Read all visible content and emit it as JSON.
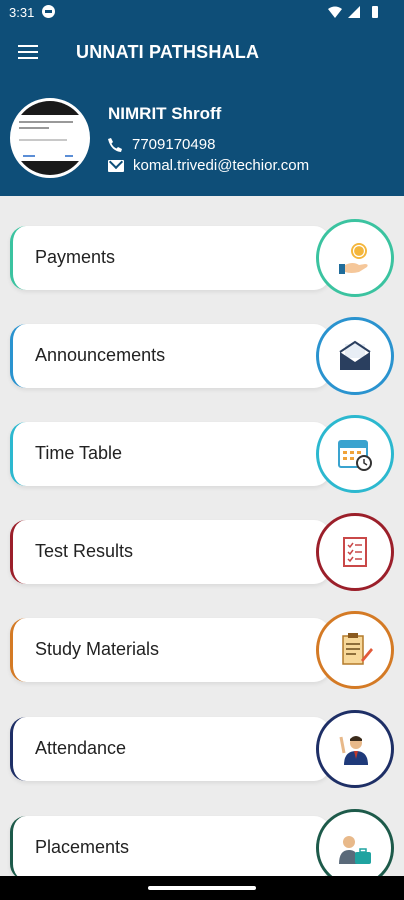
{
  "status": {
    "time": "3:31"
  },
  "appbar": {
    "title": "UNNATI PATHSHALA"
  },
  "profile": {
    "name": "NIMRIT Shroff",
    "phone": "7709170498",
    "email": "komal.trivedi@techior.com"
  },
  "menu": [
    {
      "label": "Payments",
      "color": "#3bc3a0",
      "icon": "hand-coin-icon"
    },
    {
      "label": "Announcements",
      "color": "#2a93cf",
      "icon": "envelope-icon"
    },
    {
      "label": "Time Table",
      "color": "#2cb8cf",
      "icon": "calendar-clock-icon"
    },
    {
      "label": "Test Results",
      "color": "#9b1f2a",
      "icon": "clipboard-check-icon"
    },
    {
      "label": "Study Materials",
      "color": "#d47a25",
      "icon": "notes-pencil-icon"
    },
    {
      "label": "Attendance",
      "color": "#1e2f66",
      "icon": "person-raised-hand-icon"
    },
    {
      "label": "Placements",
      "color": "#1d5a4a",
      "icon": "person-briefcase-icon"
    }
  ]
}
